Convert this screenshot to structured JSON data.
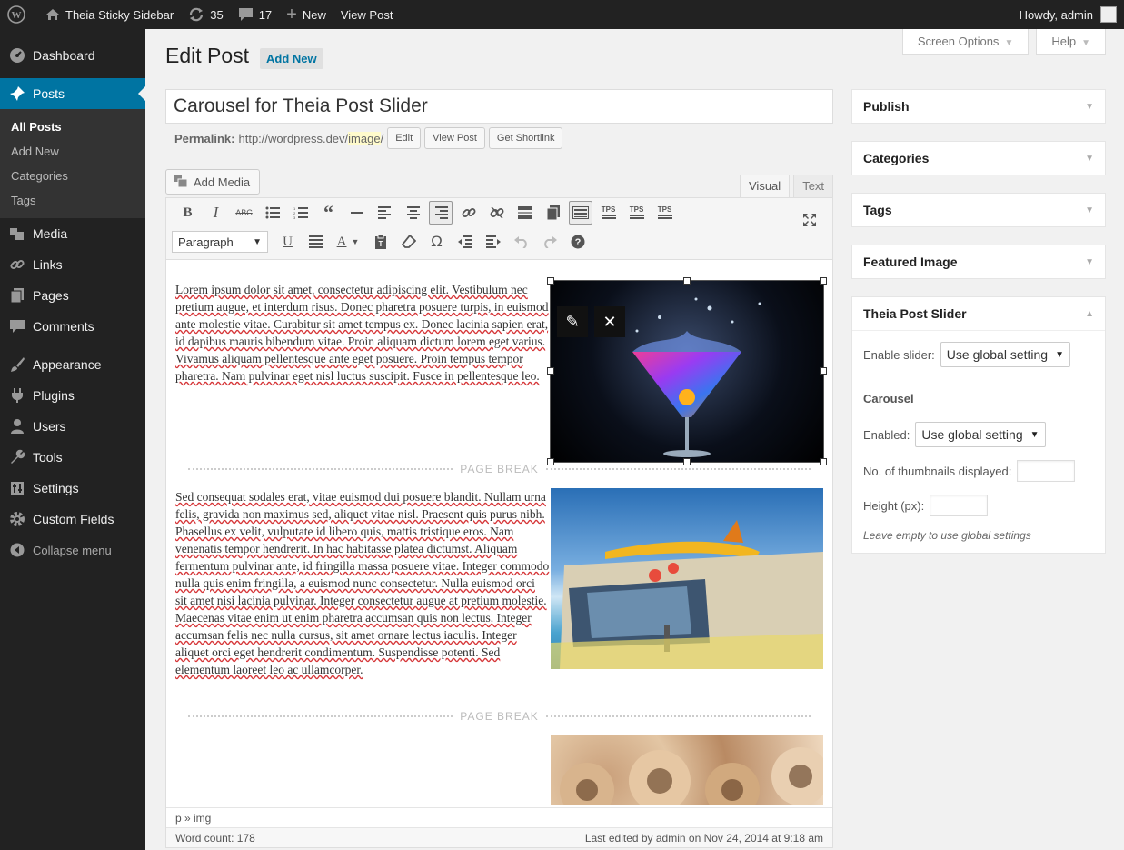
{
  "adminbar": {
    "site_name": "Theia Sticky Sidebar",
    "updates": "35",
    "comments": "17",
    "new_label": "New",
    "view_post": "View Post",
    "howdy": "Howdy, admin"
  },
  "sidebar": {
    "items": [
      {
        "label": "Dashboard",
        "icon": "dashboard-icon"
      },
      {
        "label": "Posts",
        "icon": "pin-icon"
      },
      {
        "label": "Media",
        "icon": "media-icon"
      },
      {
        "label": "Links",
        "icon": "link-icon"
      },
      {
        "label": "Pages",
        "icon": "pages-icon"
      },
      {
        "label": "Comments",
        "icon": "comments-icon"
      },
      {
        "label": "Appearance",
        "icon": "paint-brush-icon"
      },
      {
        "label": "Plugins",
        "icon": "plugin-icon"
      },
      {
        "label": "Users",
        "icon": "users-icon"
      },
      {
        "label": "Tools",
        "icon": "wrench-icon"
      },
      {
        "label": "Settings",
        "icon": "settings-icon"
      },
      {
        "label": "Custom Fields",
        "icon": "gear-icon"
      },
      {
        "label": "Collapse menu",
        "icon": "collapse-icon"
      }
    ],
    "posts_submenu": [
      "All Posts",
      "Add New",
      "Categories",
      "Tags"
    ]
  },
  "screen_tabs": {
    "screen_options": "Screen Options",
    "help": "Help"
  },
  "page": {
    "title": "Edit Post",
    "add_new": "Add New",
    "post_title": "Carousel for Theia Post Slider",
    "permalink_label": "Permalink:",
    "permalink_base": "http://wordpress.dev/",
    "permalink_slug": "image",
    "permalink_trail": "/",
    "edit_btn": "Edit",
    "view_post_btn": "View Post",
    "shortlink_btn": "Get Shortlink"
  },
  "editor": {
    "add_media": "Add Media",
    "tab_visual": "Visual",
    "tab_text": "Text",
    "format_select": "Paragraph",
    "paragraph1": "Lorem ipsum dolor sit amet, consectetur adipiscing elit. Vestibulum nec pretium augue, et interdum risus. Donec pharetra posuere turpis, in euismod ante molestie vitae. Curabitur sit amet tempus ex. Donec lacinia sapien erat, id dapibus mauris bibendum vitae. Proin aliquam dictum lorem eget varius. Vivamus aliquam pellentesque ante eget posuere. Proin tempus tempor pharetra. Nam pulvinar eget nisl luctus suscipit. Fusce in pellentesque leo.",
    "paragraph2": "Sed consequat sodales erat, vitae euismod dui posuere blandit. Nullam urna felis, gravida non maximus sed, aliquet vitae nisl. Praesent quis purus nibh. Phasellus ex velit, vulputate id libero quis, mattis tristique eros. Nam venenatis tempor hendrerit. In hac habitasse platea dictumst. Aliquam fermentum pulvinar ante, id fringilla massa posuere vitae. Integer commodo nulla quis enim fringilla, a euismod nunc consectetur. Nulla euismod orci sit amet nisi lacinia pulvinar. Integer consectetur augue at pretium molestie. Maecenas vitae enim ut enim pharetra accumsan quis non lectus. Integer accumsan felis nec nulla cursus, sit amet ornare lectus iaculis. Integer aliquet orci eget hendrerit condimentum. Suspendisse potenti. Sed elementum laoreet leo ac ullamcorper.",
    "page_break": "PAGE BREAK",
    "path": "p » img",
    "word_count": "Word count: 178",
    "last_edited": "Last edited by admin on Nov 24, 2014 at 9:18 am"
  },
  "boxes": {
    "publish": "Publish",
    "categories": "Categories",
    "tags": "Tags",
    "featured_image": "Featured Image",
    "theia": {
      "title": "Theia Post Slider",
      "enable_slider_label": "Enable slider:",
      "enable_slider_value": "Use global setting",
      "carousel_heading": "Carousel",
      "enabled_label": "Enabled:",
      "enabled_value": "Use global setting",
      "thumbs_label": "No. of thumbnails displayed:",
      "height_label": "Height (px):",
      "note": "Leave empty to use global settings"
    }
  }
}
